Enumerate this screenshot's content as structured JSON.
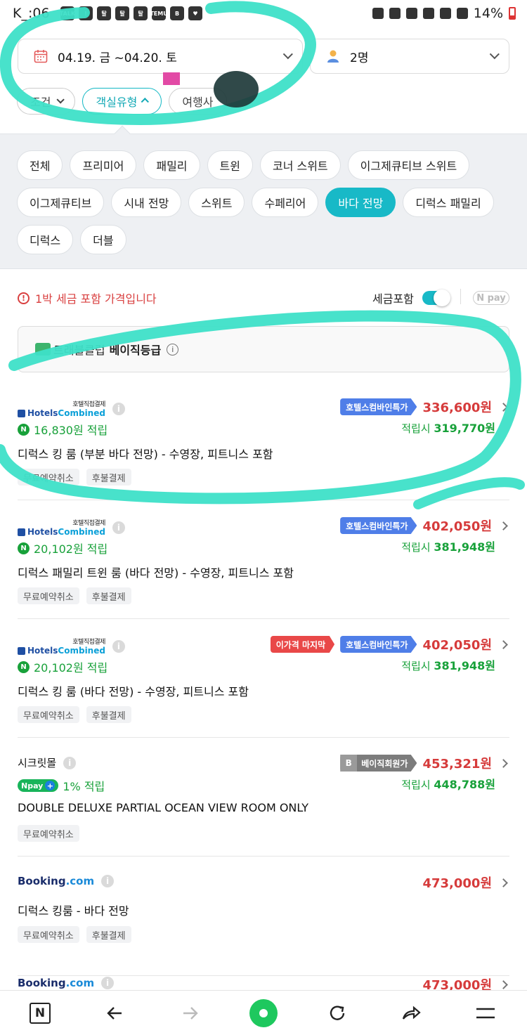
{
  "status_bar": {
    "time": "K_:06",
    "icons": [
      "TALK",
      "!",
      "탈",
      "탈",
      "탈",
      "TEMU",
      "B",
      "♥"
    ],
    "battery": "14%"
  },
  "search": {
    "dates": "04.19. 금 ~04.20. 토",
    "guests": "2명"
  },
  "filters": [
    {
      "label": "조건",
      "active": false
    },
    {
      "label": "객실유형",
      "active": true
    },
    {
      "label": "여행사",
      "active": false
    }
  ],
  "room_types": [
    [
      "전체",
      "프리미어",
      "패밀리",
      "트윈",
      "코너 스위트",
      "이그제큐티브 스위트"
    ],
    [
      "이그제큐티브",
      "시내 전망",
      "스위트",
      "수페리어",
      "바다 전망",
      "디럭스 패밀리"
    ],
    [
      "디럭스",
      "더블"
    ]
  ],
  "room_type_active": "바다 전망",
  "notice": "1박 세금 포함 가격입니다",
  "tax_toggle": {
    "label": "세금포함",
    "on": true
  },
  "npay_toggle": "N pay",
  "club": {
    "prefix": "트래블클럽",
    "grade": "베이직등급"
  },
  "listings": [
    {
      "provider": {
        "type": "hotelscombined",
        "small": "호텔직접결제",
        "brand_a": "Hotels",
        "brand_b": "Combined"
      },
      "points": "16,830원 적립",
      "points_type": "n",
      "badges": [
        {
          "label": "호텔스컴바인특가",
          "style": "blue"
        }
      ],
      "price": "336,600원",
      "after_prefix": "적립시",
      "after": "319,770원",
      "room": "디럭스 킹 룸 (부분 바다 전망) - 수영장, 피트니스 포함",
      "tags": [
        "무료예약취소",
        "후불결제"
      ]
    },
    {
      "provider": {
        "type": "hotelscombined",
        "small": "호텔직접결제",
        "brand_a": "Hotels",
        "brand_b": "Combined"
      },
      "points": "20,102원 적립",
      "points_type": "n",
      "badges": [
        {
          "label": "호텔스컴바인특가",
          "style": "blue"
        }
      ],
      "price": "402,050원",
      "after_prefix": "적립시",
      "after": "381,948원",
      "room": "디럭스 패밀리 트윈 룸 (바다 전망) - 수영장, 피트니스 포함",
      "tags": [
        "무료예약취소",
        "후불결제"
      ]
    },
    {
      "provider": {
        "type": "hotelscombined",
        "small": "호텔직접결제",
        "brand_a": "Hotels",
        "brand_b": "Combined"
      },
      "points": "20,102원 적립",
      "points_type": "n",
      "badges": [
        {
          "label": "이가격 마지막",
          "style": "red"
        },
        {
          "label": "호텔스컴바인특가",
          "style": "blue"
        }
      ],
      "price": "402,050원",
      "after_prefix": "적립시",
      "after": "381,948원",
      "room": "디럭스 킹 룸 (바다 전망) - 수영장, 피트니스 포함",
      "tags": [
        "무료예약취소",
        "후불결제"
      ]
    },
    {
      "provider": {
        "type": "plain",
        "name": "시크릿몰"
      },
      "points": "1% 적립",
      "points_type": "npay",
      "badges": [
        {
          "label": "베이직회원가",
          "style": "gray",
          "prefix": "B"
        }
      ],
      "price": "453,321원",
      "after_prefix": "적립시",
      "after": "448,788원",
      "room": "DOUBLE DELUXE PARTIAL OCEAN VIEW ROOM ONLY",
      "tags": [
        "무료예약취소"
      ]
    },
    {
      "provider": {
        "type": "booking",
        "name": "Booking",
        "suffix": ".com"
      },
      "points": "",
      "points_type": "none",
      "badges": [],
      "price": "473,000원",
      "after_prefix": "",
      "after": "",
      "room": "디럭스 킹룸 - 바다 전망",
      "tags": [
        "무료예약취소",
        "후불결제"
      ]
    },
    {
      "provider": {
        "type": "booking",
        "name": "Booking",
        "suffix": ".com"
      },
      "points": "",
      "points_type": "none",
      "badges": [],
      "price": "473,000원",
      "after_prefix": "",
      "after": "",
      "room": "",
      "tags": []
    }
  ],
  "bottom_nav": [
    "N",
    "back",
    "forward",
    "home",
    "reload",
    "share",
    "menu"
  ],
  "colors": {
    "accent": "#18b9c7",
    "price": "#d63b3b",
    "points": "#18a13a",
    "promo_blue": "#4f7ee8",
    "annotation": "#3ee0c8"
  }
}
